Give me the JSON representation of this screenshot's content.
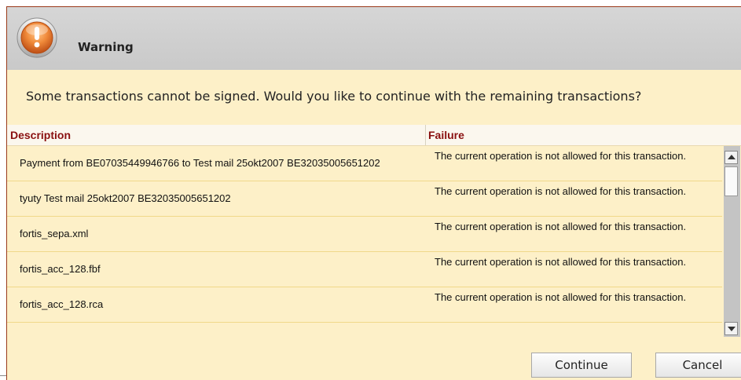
{
  "dialog": {
    "title": "Warning",
    "message": "Some transactions cannot be signed. Would you like to continue with the remaining transactions?"
  },
  "table": {
    "columns": [
      "Description",
      "Failure"
    ],
    "rows": [
      {
        "description": "Payment from BE07035449946766 to Test mail 25okt2007 BE32035005651202",
        "failure": "The current operation is not allowed for this transaction."
      },
      {
        "description": "tyuty Test mail 25okt2007 BE32035005651202",
        "failure": "The current operation is not allowed for this transaction."
      },
      {
        "description": "fortis_sepa.xml",
        "failure": "The current operation is not allowed for this transaction."
      },
      {
        "description": "fortis_acc_128.fbf",
        "failure": "The current operation is not allowed for this transaction."
      },
      {
        "description": "fortis_acc_128.rca",
        "failure": "The current operation is not allowed for this transaction."
      }
    ]
  },
  "buttons": {
    "continue_label": "Continue",
    "cancel_label": "Cancel"
  },
  "icons": {
    "warning": "exclamation-icon"
  },
  "colors": {
    "background": "#fdf0c8",
    "header_text": "#8a1010",
    "titlebar": "#cccccc",
    "icon": "#e8742a"
  }
}
